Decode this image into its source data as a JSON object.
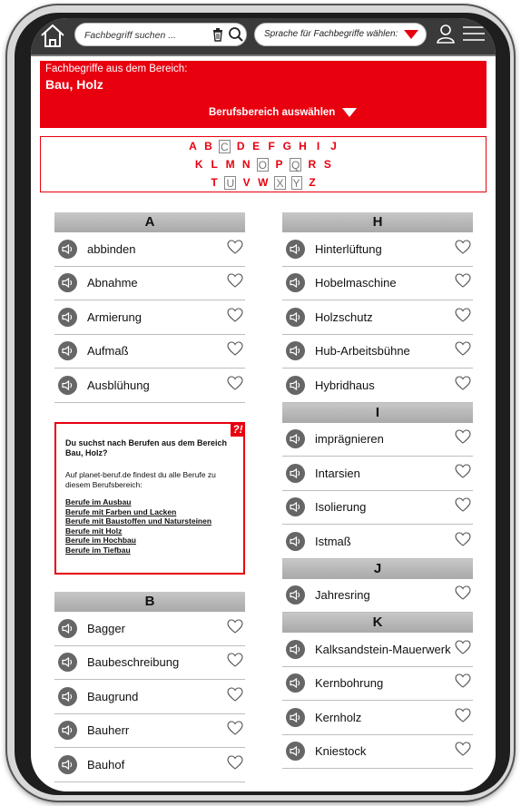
{
  "topbar": {
    "search_placeholder": "Fachbegriff suchen ...",
    "language_label": "Sprache für Fachbegriffe wählen:",
    "accent_color": "#e8000f"
  },
  "header": {
    "subtitle": "Fachbegriffe aus dem Bereich:",
    "title": "Bau, Holz",
    "select_label": "Berufsbereich auswählen"
  },
  "alphabet": {
    "rows": [
      [
        {
          "l": "A",
          "on": true
        },
        {
          "l": "B",
          "on": true
        },
        {
          "l": "C",
          "on": false
        },
        {
          "l": "D",
          "on": true
        },
        {
          "l": "E",
          "on": true
        },
        {
          "l": "F",
          "on": true
        },
        {
          "l": "G",
          "on": true
        },
        {
          "l": "H",
          "on": true
        },
        {
          "l": "I",
          "on": true
        },
        {
          "l": "J",
          "on": true
        }
      ],
      [
        {
          "l": "K",
          "on": true
        },
        {
          "l": "L",
          "on": true
        },
        {
          "l": "M",
          "on": true
        },
        {
          "l": "N",
          "on": true
        },
        {
          "l": "O",
          "on": false
        },
        {
          "l": "P",
          "on": true
        },
        {
          "l": "Q",
          "on": false
        },
        {
          "l": "R",
          "on": true
        },
        {
          "l": "S",
          "on": true
        }
      ],
      [
        {
          "l": "T",
          "on": true
        },
        {
          "l": "U",
          "on": false
        },
        {
          "l": "V",
          "on": true
        },
        {
          "l": "W",
          "on": true
        },
        {
          "l": "X",
          "on": false
        },
        {
          "l": "Y",
          "on": false
        },
        {
          "l": "Z",
          "on": true
        }
      ]
    ]
  },
  "left_sections": [
    {
      "letter": "A",
      "terms": [
        "abbinden",
        "Abnahme",
        "Armierung",
        "Aufmaß",
        "Ausblühung"
      ]
    }
  ],
  "left_sections_after": [
    {
      "letter": "B",
      "terms": [
        "Bagger",
        "Baubeschreibung",
        "Baugrund",
        "Bauherr",
        "Bauhof"
      ]
    }
  ],
  "right_sections": [
    {
      "letter": "H",
      "terms": [
        "Hinterlüftung",
        "Hobelmaschine",
        "Holzschutz",
        "Hub-Arbeitsbühne",
        "Hybridhaus"
      ]
    },
    {
      "letter": "I",
      "terms": [
        "imprägnieren",
        "Intarsien",
        "Isolierung",
        "Istmaß"
      ]
    },
    {
      "letter": "J",
      "terms": [
        "Jahresring"
      ]
    },
    {
      "letter": "K",
      "terms": [
        "Kalksandstein-Mauerwerk",
        "Kernbohrung",
        "Kernholz",
        "Kniestock"
      ]
    }
  ],
  "info": {
    "badge": "?!",
    "title": "Du suchst nach Berufen aus dem Bereich Bau, Holz?",
    "text": "Auf planet-beruf.de findest du alle Berufe zu diesem Berufsbereich:",
    "links": [
      "Berufe im Ausbau",
      "Berufe mit Farben und Lacken",
      "Berufe mit Baustoffen und Natursteinen",
      "Berufe mit Holz",
      "Berufe im Hochbau",
      "Berufe im Tiefbau"
    ]
  }
}
